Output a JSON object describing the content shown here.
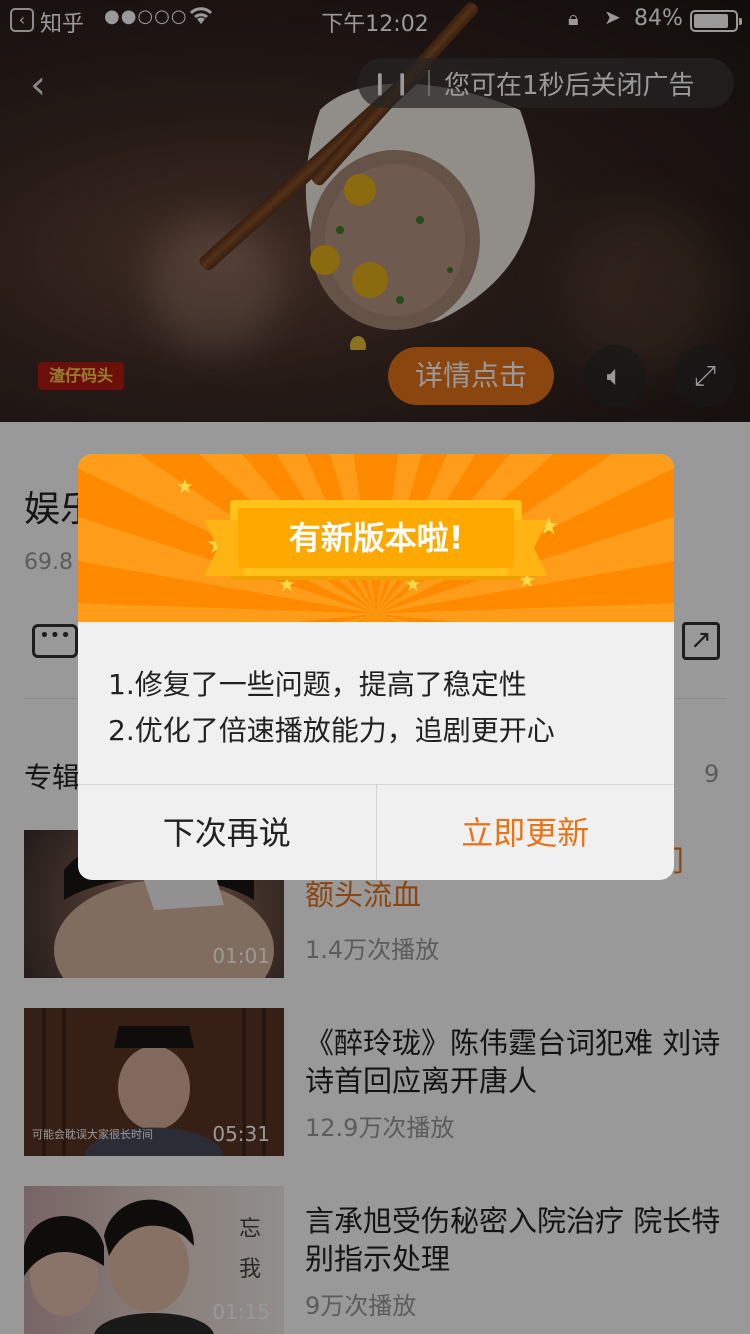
{
  "status_bar": {
    "back_app": "知乎",
    "signal": "●●○○○",
    "time": "下午12:02",
    "battery": "84%"
  },
  "ad": {
    "close_notice": "您可在1秒后关闭广告",
    "brand": "渣仔码头",
    "detail_button": "详情点击"
  },
  "video_info": {
    "title": "娱乐",
    "views": "69.8"
  },
  "section": {
    "label": "专辑",
    "count": "9"
  },
  "videos": [
    {
      "title": "额头流血",
      "plays": "1.4万次播放",
      "duration": "01:01",
      "partial_title_right": "门"
    },
    {
      "title": "《醉玲珑》陈伟霆台词犯难 刘诗诗首回应离开唐人",
      "plays": "12.9万次播放",
      "duration": "05:31",
      "subtitle": "可能会耽误大家很长时间"
    },
    {
      "title": "言承旭受伤秘密入院治疗 院长特别指示处理",
      "plays": "9万次播放",
      "duration": "01:15"
    }
  ],
  "dialog": {
    "banner_title": "有新版本啦!",
    "line1": "1.修复了一些问题，提高了稳定性",
    "line2": "2.优化了倍速播放能力，追剧更开心",
    "later_button": "下次再说",
    "update_button": "立即更新"
  },
  "colors": {
    "accent": "#e8741a",
    "banner": "#ff8a00"
  }
}
